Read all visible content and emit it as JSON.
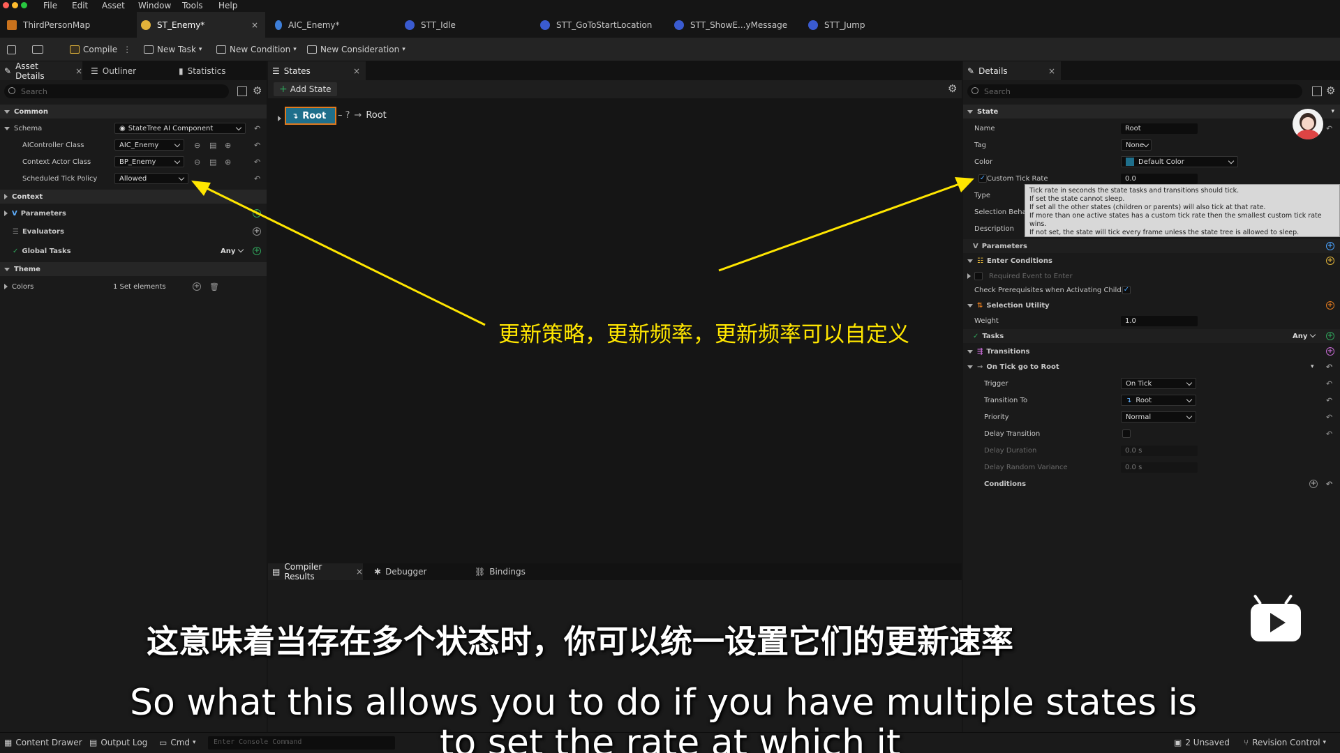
{
  "menu": [
    "File",
    "Edit",
    "Asset",
    "Window",
    "Tools",
    "Help"
  ],
  "doc_tabs": [
    {
      "label": "ThirdPersonMap"
    },
    {
      "label": "ST_Enemy*"
    },
    {
      "label": "AIC_Enemy*"
    },
    {
      "label": "STT_Idle"
    },
    {
      "label": "STT_GoToStartLocation"
    },
    {
      "label": "STT_ShowE...yMessage"
    },
    {
      "label": "STT_Jump"
    }
  ],
  "toolbar": {
    "compile": "Compile",
    "new_task": "New Task",
    "new_condition": "New Condition",
    "new_consideration": "New Consideration"
  },
  "left_panel": {
    "tabs": [
      "Asset Details",
      "Outliner",
      "Statistics"
    ],
    "search_placeholder": "Search",
    "common": "Common",
    "schema_label": "Schema",
    "schema_value": "StateTree AI Component",
    "aicontroller_label": "AIController Class",
    "aicontroller_value": "AIC_Enemy",
    "context_actor_label": "Context Actor Class",
    "context_actor_value": "BP_Enemy",
    "tick_policy_label": "Scheduled Tick Policy",
    "tick_policy_value": "Allowed",
    "context": "Context",
    "parameters": "Parameters",
    "evaluators": "Evaluators",
    "global_tasks": "Global Tasks",
    "global_tasks_value": "Any",
    "theme": "Theme",
    "colors_label": "Colors",
    "colors_value": "1 Set elements"
  },
  "states_panel": {
    "tab": "States",
    "add_state": "Add State",
    "root_node": "Root",
    "transition_symbol": "?",
    "transition_target": "Root"
  },
  "bottom_tabs": [
    "Compiler Results",
    "Debugger",
    "Bindings"
  ],
  "details": {
    "tab": "Details",
    "search_placeholder": "Search",
    "state_cat": "State",
    "name_label": "Name",
    "name_value": "Root",
    "tag_label": "Tag",
    "tag_value": "None",
    "color_label": "Color",
    "color_value": "Default Color",
    "custom_tick_label": "Custom Tick Rate",
    "custom_tick_value": "0.0",
    "type_label": "Type",
    "selection_label": "Selection Beha",
    "description_label": "Description",
    "tooltip": [
      "Tick rate in seconds the state tasks and transitions should tick.",
      "If set the state cannot sleep.",
      "If set all the other states (children or parents) will also tick at that rate.",
      "If more than one active states has a custom tick rate then the smallest custom tick rate wins.",
      "If not set, the state will tick every frame unless the state tree is allowed to sleep."
    ],
    "parameters": "Parameters",
    "enter_conditions": "Enter Conditions",
    "required_event": "Required Event to Enter",
    "check_prereq": "Check Prerequisites when Activating Child...",
    "selection_utility": "Selection Utility",
    "weight_label": "Weight",
    "weight_value": "1.0",
    "tasks": "Tasks",
    "tasks_value": "Any",
    "transitions": "Transitions",
    "on_tick": "On Tick go to Root",
    "trigger_label": "Trigger",
    "trigger_value": "On Tick",
    "transition_to_label": "Transition To",
    "transition_to_value": "Root",
    "priority_label": "Priority",
    "priority_value": "Normal",
    "delay_transition": "Delay Transition",
    "delay_duration": "Delay Duration",
    "delay_duration_value": "0.0 s",
    "delay_random": "Delay Random Variance",
    "delay_random_value": "0.0 s",
    "conditions": "Conditions"
  },
  "annotation": "更新策略，更新频率，更新频率可以自定义",
  "subtitle_cn": "这意味着当存在多个状态时，你可以统一设置它们的更新速率",
  "subtitle_en_line1": "So what this allows you to do if you have multiple states is",
  "subtitle_en_line2": "to set the rate at which it",
  "statusbar": {
    "content_drawer": "Content Drawer",
    "output_log": "Output Log",
    "cmd": "Cmd",
    "console_placeholder": "Enter Console Command",
    "unsaved": "2 Unsaved",
    "revision": "Revision Control"
  },
  "colors": {
    "accent_yellow": "#ffe600",
    "root_node": "#1f6f8b",
    "selection_orange": "#e07a1f"
  }
}
